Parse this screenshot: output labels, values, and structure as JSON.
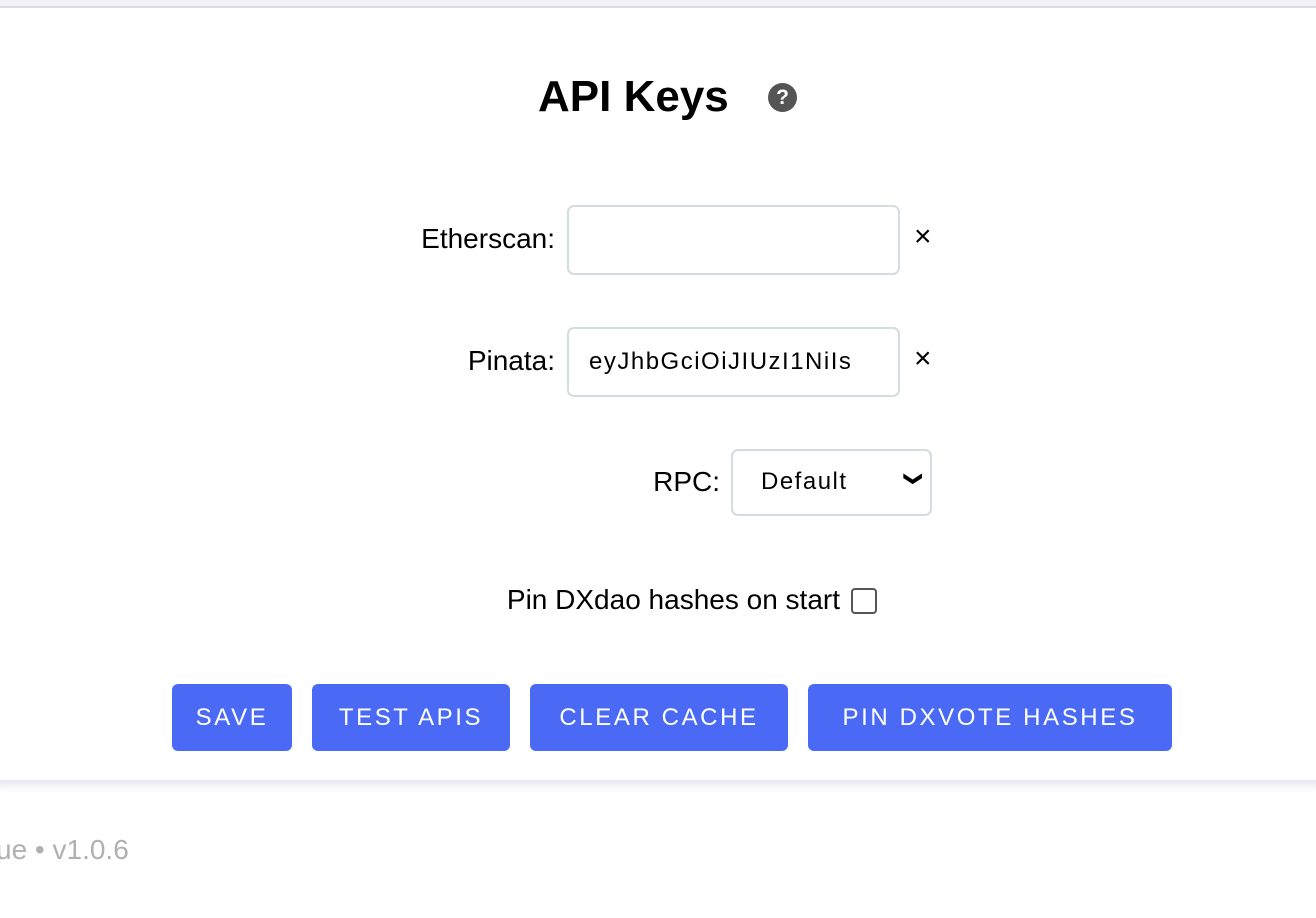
{
  "header": {
    "title": "API Keys",
    "help_icon": "question-circle-icon"
  },
  "form": {
    "etherscan": {
      "label": "Etherscan:",
      "value": "",
      "clear_icon": "×"
    },
    "pinata": {
      "label": "Pinata:",
      "value": "eyJhbGciOiJIUzI1NiIs",
      "clear_icon": "×"
    },
    "rpc": {
      "label": "RPC:",
      "selected": "Default",
      "chevron": "⌄"
    },
    "pin_hashes": {
      "label": "Pin DXdao hashes on start",
      "checked": false
    }
  },
  "buttons": {
    "save": "SAVE",
    "test_apis": "TEST APIS",
    "clear_cache": "CLEAR CACHE",
    "pin_hashes": "PIN DXVOTE HASHES"
  },
  "footer": {
    "text": "ue • v1.0.6"
  },
  "colors": {
    "button": "#4a6af5",
    "footer_text": "#b0b0b0"
  }
}
